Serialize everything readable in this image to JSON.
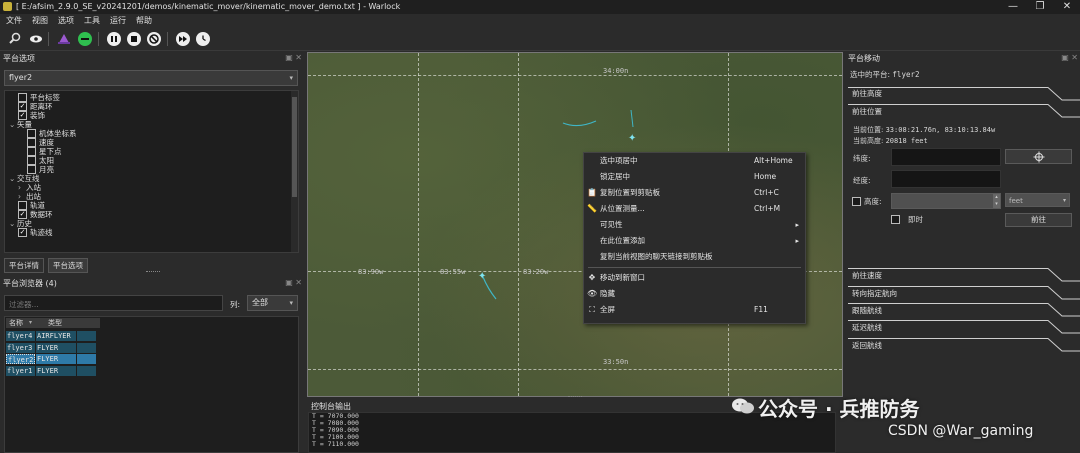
{
  "window": {
    "title": "[ E:/afsim_2.9.0_SE_v20241201/demos/kinematic_mover/kinematic_mover_demo.txt ] - Warlock",
    "min": "—",
    "max": "❐",
    "close": "✕"
  },
  "menu": [
    "文件",
    "视图",
    "选项",
    "工具",
    "运行",
    "帮助"
  ],
  "colors": {
    "accent": "#3fb6c6",
    "ctx_hover": "#3d6e8c",
    "grid_row": "#1f4f63",
    "grid_selected": "#2e7aa8",
    "play_green": "#2fbf4f",
    "purple": "#9b59d0"
  },
  "toolbar": {
    "icons": [
      "magnifier-icon",
      "eye-icon",
      "hat-icon",
      "minus-circle-icon",
      "pause-icon",
      "stop-icon",
      "no-entry-icon",
      "fast-forward-icon",
      "clock-icon"
    ]
  },
  "platform_options": {
    "title": "平台选项",
    "selected_platform": "flyer2",
    "tree": [
      {
        "label": "平台标签",
        "indent": 1,
        "checkbox": true,
        "checked": false
      },
      {
        "label": "距离环",
        "indent": 1,
        "checkbox": true,
        "checked": true
      },
      {
        "label": "装饰",
        "indent": 1,
        "checkbox": true,
        "checked": true
      },
      {
        "label": "矢量",
        "indent": 0,
        "arrow": "⌄"
      },
      {
        "label": "机体坐标系",
        "indent": 2,
        "checkbox": true,
        "checked": false
      },
      {
        "label": "速度",
        "indent": 2,
        "checkbox": true,
        "checked": false
      },
      {
        "label": "星下点",
        "indent": 2,
        "checkbox": true,
        "checked": false
      },
      {
        "label": "太阳",
        "indent": 2,
        "checkbox": true,
        "checked": false
      },
      {
        "label": "月亮",
        "indent": 2,
        "checkbox": true,
        "checked": false
      },
      {
        "label": "交互线",
        "indent": 0,
        "arrow": "⌄"
      },
      {
        "label": "入站",
        "indent": 1,
        "arrow": "›"
      },
      {
        "label": "出站",
        "indent": 1,
        "arrow": "›"
      },
      {
        "label": "轨道",
        "indent": 1,
        "checkbox": true,
        "checked": false
      },
      {
        "label": "数据环",
        "indent": 1,
        "checkbox": true,
        "checked": true
      },
      {
        "label": "历史",
        "indent": 0,
        "arrow": "⌄"
      },
      {
        "label": "轨迹线",
        "indent": 1,
        "checkbox": true,
        "checked": true
      }
    ],
    "tabs": [
      "平台详情",
      "平台选项"
    ]
  },
  "platform_browser": {
    "title": "平台浏览器 (4)",
    "filter_placeholder": "过滤器...",
    "column_label": "列:",
    "column_value": "全部",
    "headers": [
      "名称",
      "类型"
    ],
    "rows": [
      {
        "name": "flyer4",
        "type": "AIRFLYER",
        "selected": false
      },
      {
        "name": "flyer3",
        "type": "FLYER",
        "selected": false
      },
      {
        "name": "flyer2",
        "type": "FLYER",
        "selected": true
      },
      {
        "name": "flyer1",
        "type": "FLYER",
        "selected": false
      }
    ]
  },
  "map": {
    "labels": {
      "top_lon": "34:00n",
      "bottom_lon": "33:50n",
      "left_lat": "83:90w",
      "mid_lat": "83:55w",
      "right_lat": "83:20w"
    }
  },
  "context_menu": {
    "items": [
      {
        "label": "选中项居中",
        "shortcut": "Alt+Home",
        "icon": "",
        "icon_name": ""
      },
      {
        "label": "锁定居中",
        "shortcut": "Home",
        "icon": "",
        "icon_name": ""
      },
      {
        "label": "复制位置到剪贴板",
        "shortcut": "Ctrl+C",
        "icon": "📋",
        "icon_name": "clipboard-icon"
      },
      {
        "label": "从位置测量...",
        "shortcut": "Ctrl+M",
        "icon": "📏",
        "icon_name": "ruler-icon"
      },
      {
        "label": "可见性",
        "shortcut": "",
        "icon": "",
        "icon_name": "",
        "submenu": "▸"
      },
      {
        "label": "在此位置添加",
        "shortcut": "",
        "icon": "",
        "icon_name": "",
        "submenu": "▸"
      },
      {
        "label": "复制当前视图的聊天链接到剪贴板",
        "shortcut": "",
        "icon": "",
        "icon_name": ""
      },
      {
        "label": "移动到新窗口",
        "shortcut": "",
        "icon": "✥",
        "icon_name": "move-icon",
        "sep_before": true
      },
      {
        "label": "隐藏",
        "shortcut": "",
        "icon": "👁",
        "icon_name": "hide-eye-icon"
      },
      {
        "label": "全屏",
        "shortcut": "F11",
        "icon": "⛶",
        "icon_name": "fullscreen-icon"
      }
    ]
  },
  "platform_movement": {
    "title": "平台移动",
    "selected_label": "选中的平台:",
    "selected_value": "flyer2",
    "sections_top": [
      "前往高度",
      "前往位置"
    ],
    "current_position_label": "当前位置:",
    "current_position_value": "33:08:21.76n, 83:10:13.84w",
    "current_altitude_label": "当前高度:",
    "current_altitude_value": "20818 feet",
    "lat_label": "纬度:",
    "lon_label": "经度:",
    "alt_label": "高度:",
    "alt_unit": "feet",
    "immediate_label": "即时",
    "go_button": "前往",
    "sections_bottom": [
      "前往速度",
      "转向指定航向",
      "跟随航线",
      "延迟航线",
      "返回航线"
    ]
  },
  "console": {
    "title": "控制台输出",
    "lines": [
      "T = 7070.000",
      "T = 7080.000",
      "T = 7090.000",
      "T = 7100.000",
      "T = 7110.000"
    ]
  },
  "watermark": {
    "line1": "公众号 · 兵推防务",
    "line2": "CSDN @War_gaming"
  }
}
